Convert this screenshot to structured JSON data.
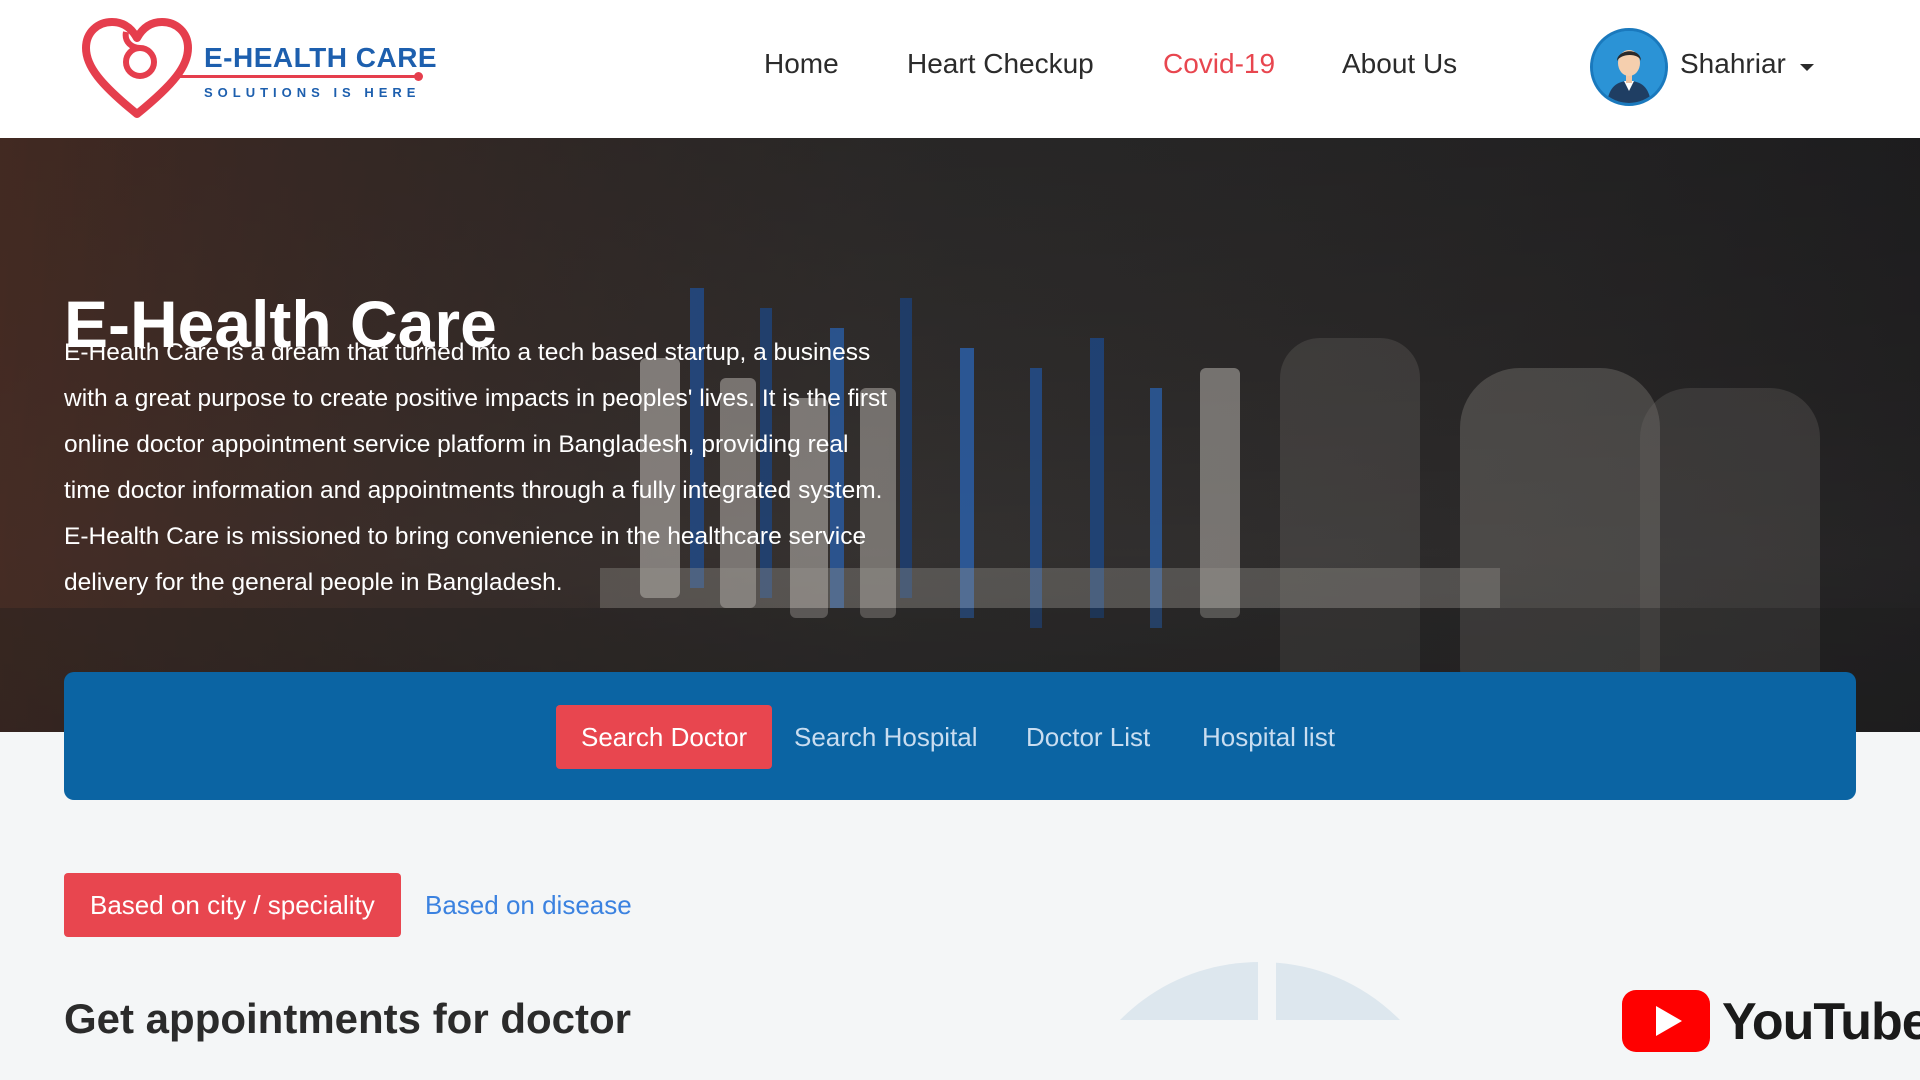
{
  "brand": {
    "name": "E-HEALTH CARE",
    "tagline": "SOLUTIONS IS HERE"
  },
  "nav": {
    "items": [
      {
        "label": "Home",
        "active": false
      },
      {
        "label": "Heart Checkup",
        "active": false
      },
      {
        "label": "Covid-19",
        "active": true
      },
      {
        "label": "About Us",
        "active": false
      }
    ]
  },
  "user": {
    "name": "Shahriar"
  },
  "hero": {
    "title": "E-Health Care",
    "lines": [
      "E-Health Care is a dream that turned into a tech based startup, a business",
      "with a great purpose to create positive impacts in peoples' lives. It is the first",
      "online doctor appointment service platform in Bangladesh, providing real",
      "time doctor information and appointments through a fully integrated system.",
      "E-Health Care is missioned to bring convenience in the healthcare service",
      "delivery for the general people in Bangladesh."
    ]
  },
  "search_tabs": {
    "items": [
      {
        "label": "Search Doctor",
        "active": true
      },
      {
        "label": "Search Hospital",
        "active": false
      },
      {
        "label": "Doctor List",
        "active": false
      },
      {
        "label": "Hospital list",
        "active": false
      }
    ]
  },
  "filter": {
    "city_speciality": "Based on city / speciality",
    "disease": "Based on disease"
  },
  "section": {
    "title": "Get appointments for doctor"
  },
  "watermark": {
    "label": "YouTube",
    "icon": "play-icon"
  },
  "colors": {
    "accent_red": "#e8464f",
    "brand_blue": "#0b64a3",
    "link_blue": "#3b82e0"
  }
}
